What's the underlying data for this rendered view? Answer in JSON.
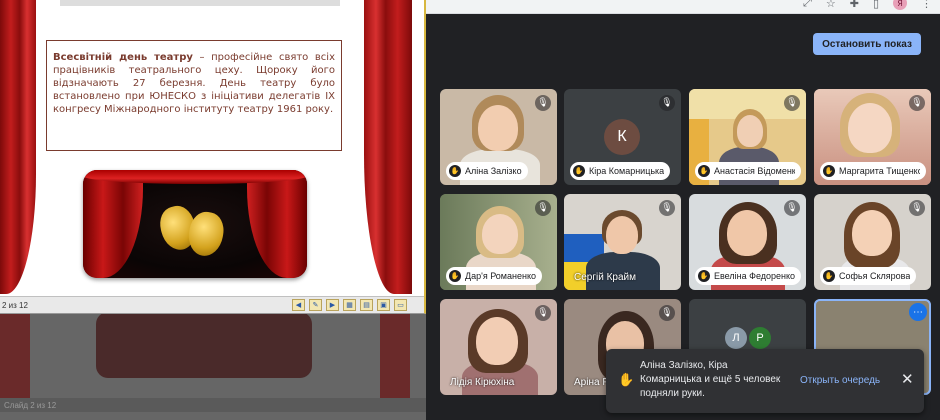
{
  "presentation": {
    "heading_bold": "Всесвітній день театру",
    "body_text": " – професійне свято всіх працівників театрального цеху. Щороку його відзначають 27 березня. День театру було встановлено при ЮНЕСКО з ініціативи делегатів IX конгресу Міжнародного інституту театру 1961 року.",
    "status_page": "2 из 12",
    "ghost_page": "Слайд 2 из 12"
  },
  "chrome": {
    "icons": [
      "menu-dots-icon",
      "star-icon",
      "puzzle-icon",
      "bookmark-icon",
      "avatar-icon"
    ],
    "avatar_letter": "Я"
  },
  "meet": {
    "stop_button": "Остановить показ",
    "tiles": [
      {
        "name": "Аліна Залізко",
        "hand": true
      },
      {
        "name": "Кіра Комарницька",
        "hand": true,
        "initial": "К"
      },
      {
        "name": "Анастасія Відоменко",
        "hand": true
      },
      {
        "name": "Маргарита Тищенко",
        "hand": true
      },
      {
        "name": "Дар'я Романенко",
        "hand": true
      },
      {
        "name": "Сергій Крайм",
        "hand": false
      },
      {
        "name": "Евеліна Федоренко",
        "hand": true
      },
      {
        "name": "Софья Склярова",
        "hand": true
      },
      {
        "name": "Лідія Кірюхіна",
        "hand": false
      },
      {
        "name": "Аріна Р",
        "hand": false
      },
      {
        "initials": [
          "Л",
          "Р"
        ]
      },
      {
        "name": ""
      }
    ]
  },
  "toast": {
    "message": "Аліна Залізко, Кіра Комарницька и ещё 5 человек подняли руки.",
    "link": "Открыть очередь",
    "close": "✕"
  }
}
